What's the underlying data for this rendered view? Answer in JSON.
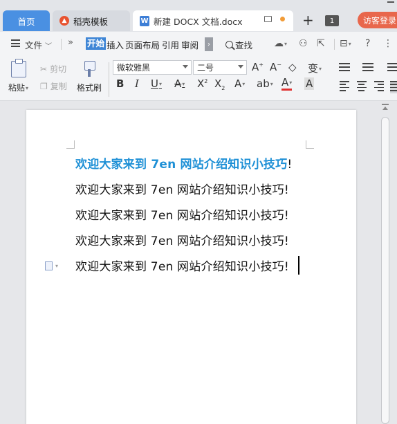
{
  "tabs": {
    "home": "首页",
    "template": "稻壳模板",
    "document": "新建 DOCX 文档.docx"
  },
  "titlebar": {
    "tab_count": "1",
    "login": "访客登录"
  },
  "menu": {
    "file": "文件",
    "tabs": [
      "开始",
      "插入",
      "页面布局",
      "引用",
      "审阅"
    ],
    "find": "查找"
  },
  "toolbar": {
    "paste": "粘贴",
    "cut": "剪切",
    "copy": "复制",
    "format_painter": "格式刷",
    "font_name": "微软雅黑",
    "font_size": "二号"
  },
  "document": {
    "lines": [
      "欢迎大家来到 7en 网站介绍知识小技巧!",
      "欢迎大家来到 7en 网站介绍知识小技巧!",
      "欢迎大家来到 7en 网站介绍知识小技巧!",
      "欢迎大家来到 7en 网站介绍知识小技巧!",
      "欢迎大家来到 7en 网站介绍知识小技巧!"
    ],
    "heading_text": "欢迎大家来到 7en 网站介绍知识小技巧",
    "heading_punct": "!"
  },
  "colors": {
    "accent": "#3f86d6",
    "heading": "#1e90d6",
    "login": "#e8674c"
  }
}
